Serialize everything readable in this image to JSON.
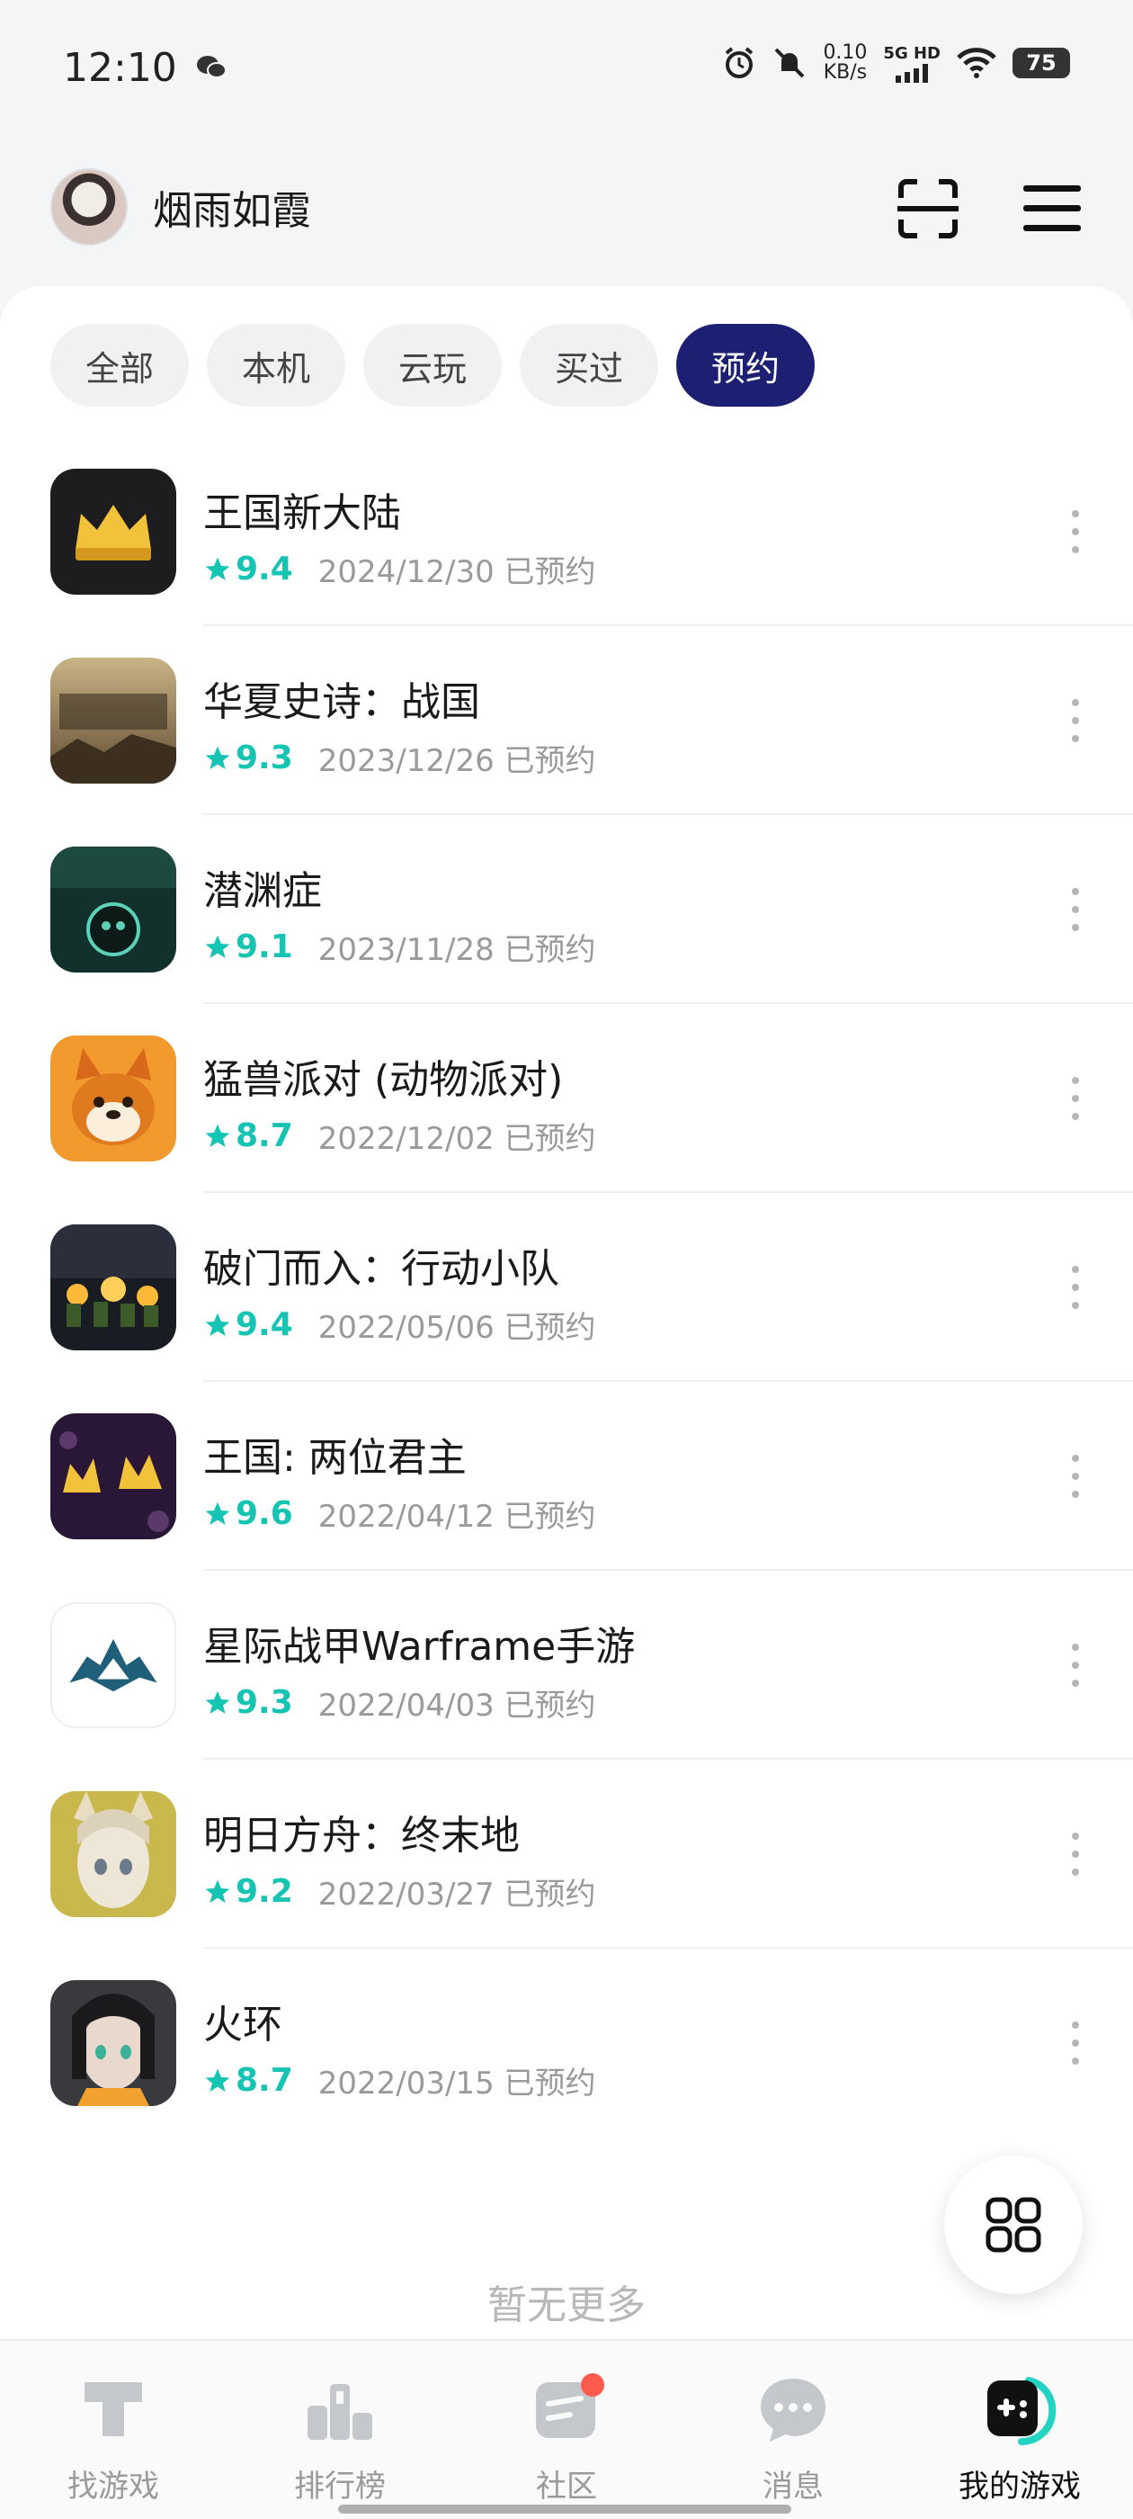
{
  "status_bar": {
    "time": "12:10",
    "net_speed_value": "0.10",
    "net_speed_unit": "KB/s",
    "network_label": "5G HD",
    "battery": "75"
  },
  "header": {
    "username": "烟雨如霞"
  },
  "tabs": [
    {
      "label": "全部",
      "active": false
    },
    {
      "label": "本机",
      "active": false
    },
    {
      "label": "云玩",
      "active": false
    },
    {
      "label": "买过",
      "active": false
    },
    {
      "label": "预约",
      "active": true
    }
  ],
  "games": [
    {
      "name": "王国新大陆",
      "score": "9.4",
      "reserved": "2024/12/30 已预约"
    },
    {
      "name": "华夏史诗：战国",
      "score": "9.3",
      "reserved": "2023/12/26 已预约"
    },
    {
      "name": "潜渊症",
      "score": "9.1",
      "reserved": "2023/11/28 已预约"
    },
    {
      "name": "猛兽派对 (动物派对)",
      "score": "8.7",
      "reserved": "2022/12/02 已预约"
    },
    {
      "name": "破门而入：行动小队",
      "score": "9.4",
      "reserved": "2022/05/06 已预约"
    },
    {
      "name": "王国: 两位君主",
      "score": "9.6",
      "reserved": "2022/04/12 已预约"
    },
    {
      "name": "星际战甲Warframe手游",
      "score": "9.3",
      "reserved": "2022/04/03 已预约"
    },
    {
      "name": "明日方舟：终末地",
      "score": "9.2",
      "reserved": "2022/03/27 已预约"
    },
    {
      "name": "火环",
      "score": "8.7",
      "reserved": "2022/03/15 已预约"
    }
  ],
  "footer_text": "暂无更多",
  "bottom_nav": [
    {
      "label": "找游戏",
      "icon": "find-games-icon"
    },
    {
      "label": "排行榜",
      "icon": "ranking-icon"
    },
    {
      "label": "社区",
      "icon": "community-icon"
    },
    {
      "label": "消息",
      "icon": "message-icon"
    },
    {
      "label": "我的游戏",
      "icon": "my-games-icon"
    }
  ],
  "colors": {
    "accent_tab": "#1d1f73",
    "score": "#16c4b4",
    "badge": "#ff5a4e"
  }
}
